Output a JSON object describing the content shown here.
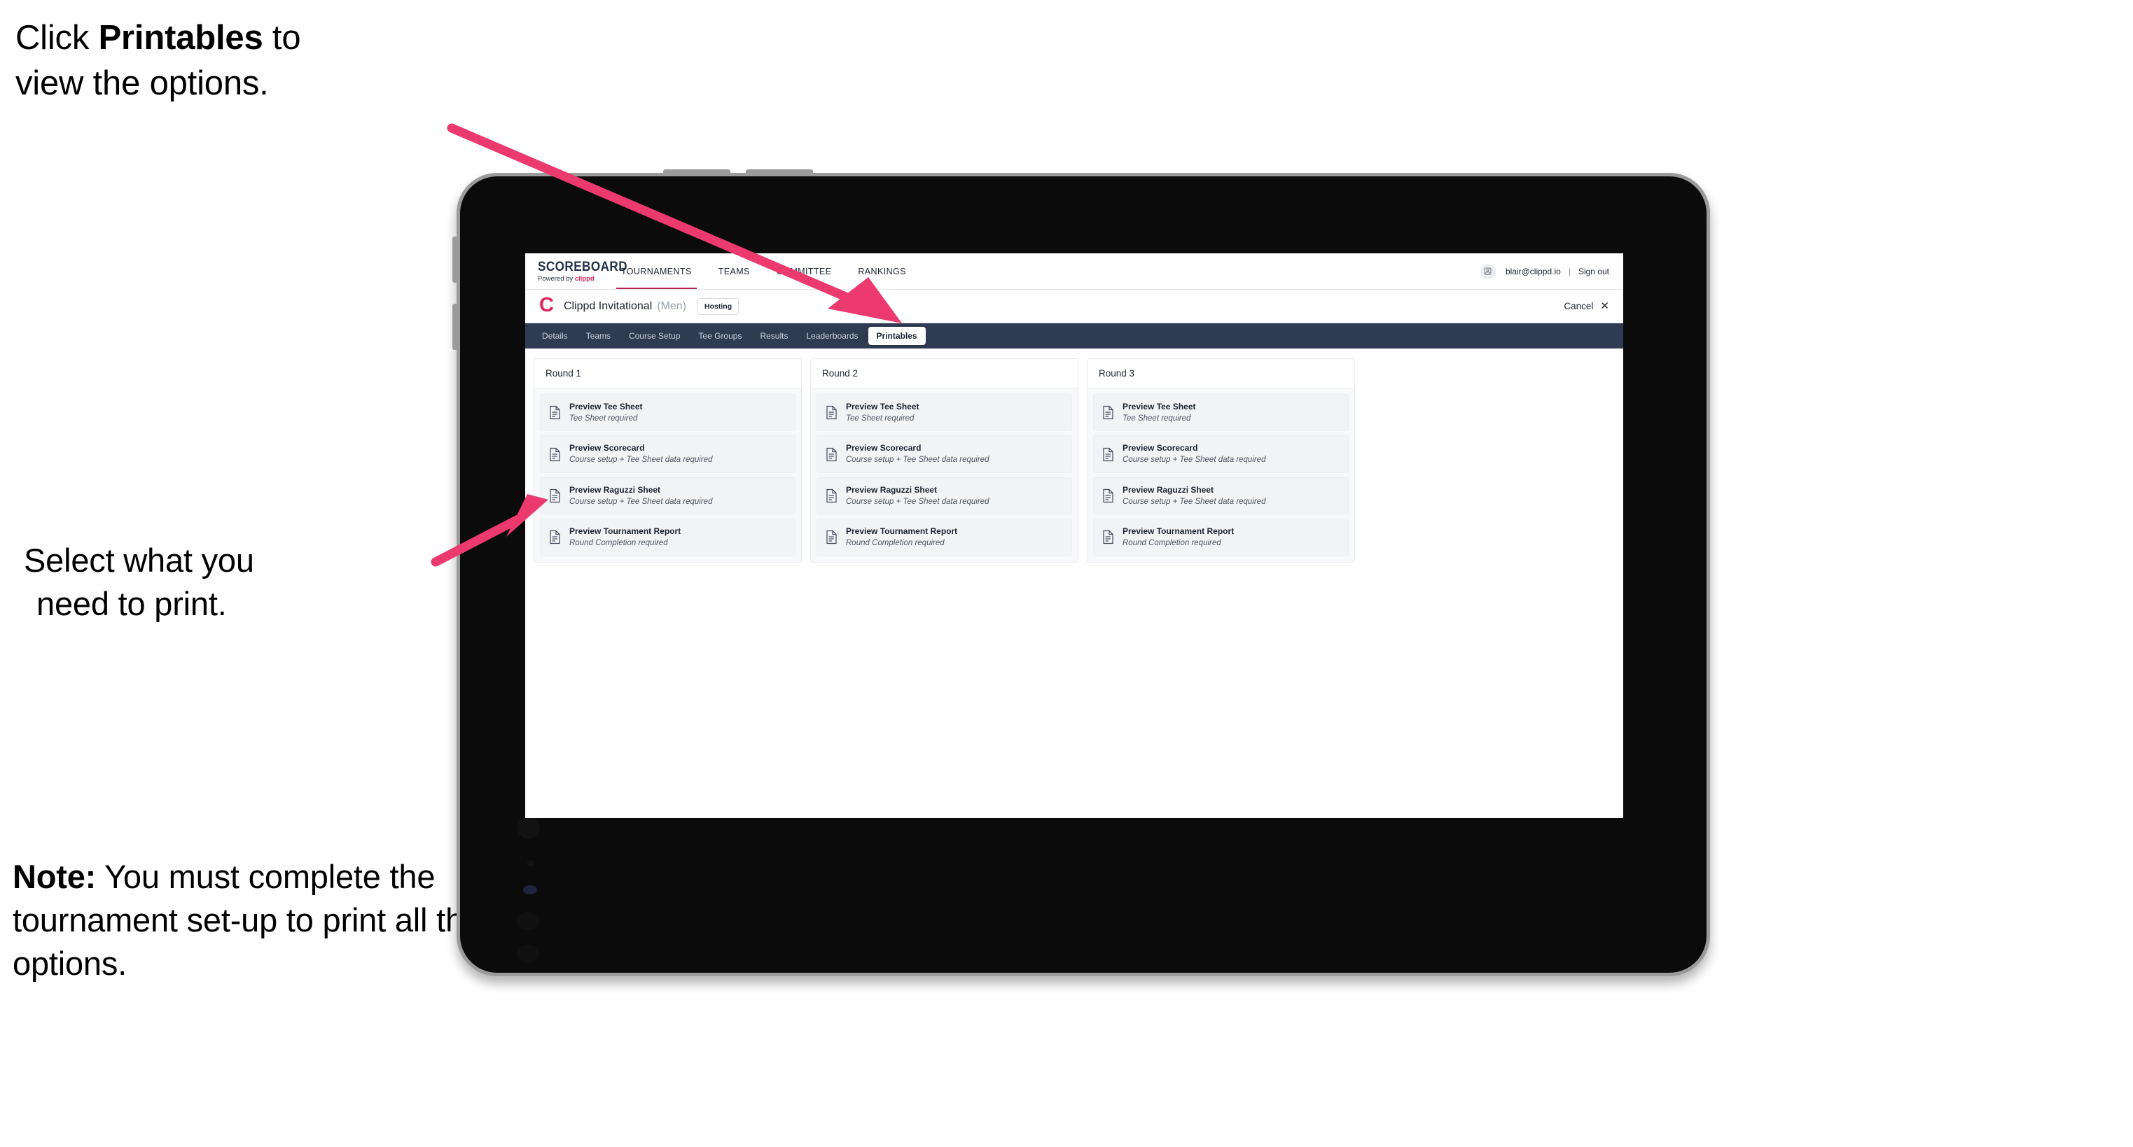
{
  "annotations": {
    "click_printables": {
      "line1_pre": "Click ",
      "line1_bold": "Printables",
      "line1_post": " to",
      "line2": "view the options."
    },
    "select_print": {
      "line1": "Select what you",
      "line2": "need to print."
    },
    "note": {
      "bold": "Note:",
      "text": " You must complete the tournament set-up to print all the options."
    }
  },
  "app": {
    "brand": {
      "title": "SCOREBOARD",
      "powered_prefix": "Powered by ",
      "powered_name": "clippd"
    },
    "topnav": {
      "items": [
        {
          "label": "TOURNAMENTS",
          "active": true
        },
        {
          "label": "TEAMS",
          "active": false
        },
        {
          "label": "COMMITTEE",
          "active": false
        },
        {
          "label": "RANKINGS",
          "active": false
        }
      ],
      "user_email": "blair@clippd.io",
      "separator": "|",
      "sign_out": "Sign out",
      "avatar_icon": "user-avatar-icon"
    },
    "subheader": {
      "logo_letter": "C",
      "tournament_name": "Clippd Invitational",
      "gender": "(Men)",
      "status_badge": "Hosting",
      "cancel_label": "Cancel",
      "cancel_icon": "close-icon"
    },
    "tabs": [
      {
        "label": "Details",
        "active": false
      },
      {
        "label": "Teams",
        "active": false
      },
      {
        "label": "Course Setup",
        "active": false
      },
      {
        "label": "Tee Groups",
        "active": false
      },
      {
        "label": "Results",
        "active": false
      },
      {
        "label": "Leaderboards",
        "active": false
      },
      {
        "label": "Printables",
        "active": true
      }
    ],
    "rounds": [
      {
        "title": "Round 1",
        "items": [
          {
            "title": "Preview Tee Sheet",
            "requirement": "Tee Sheet required",
            "icon": "document-icon"
          },
          {
            "title": "Preview Scorecard",
            "requirement": "Course setup + Tee Sheet data required",
            "icon": "document-icon"
          },
          {
            "title": "Preview Raguzzi Sheet",
            "requirement": "Course setup + Tee Sheet data required",
            "icon": "document-icon"
          },
          {
            "title": "Preview Tournament Report",
            "requirement": "Round Completion required",
            "icon": "document-icon"
          }
        ]
      },
      {
        "title": "Round 2",
        "items": [
          {
            "title": "Preview Tee Sheet",
            "requirement": "Tee Sheet required",
            "icon": "document-icon"
          },
          {
            "title": "Preview Scorecard",
            "requirement": "Course setup + Tee Sheet data required",
            "icon": "document-icon"
          },
          {
            "title": "Preview Raguzzi Sheet",
            "requirement": "Course setup + Tee Sheet data required",
            "icon": "document-icon"
          },
          {
            "title": "Preview Tournament Report",
            "requirement": "Round Completion required",
            "icon": "document-icon"
          }
        ]
      },
      {
        "title": "Round 3",
        "items": [
          {
            "title": "Preview Tee Sheet",
            "requirement": "Tee Sheet required",
            "icon": "document-icon"
          },
          {
            "title": "Preview Scorecard",
            "requirement": "Course setup + Tee Sheet data required",
            "icon": "document-icon"
          },
          {
            "title": "Preview Raguzzi Sheet",
            "requirement": "Course setup + Tee Sheet data required",
            "icon": "document-icon"
          },
          {
            "title": "Preview Tournament Report",
            "requirement": "Round Completion required",
            "icon": "document-icon"
          }
        ]
      }
    ]
  },
  "colors": {
    "accent_pink": "#e0255e",
    "arrow_pink": "#ed3a6e",
    "tabstrip_navy": "#2f3b52",
    "brand_navy": "#21304a",
    "active_underline": "#b7264b",
    "bezel": "#0b0b0b",
    "bezel_edge": "#9b9b9b"
  }
}
